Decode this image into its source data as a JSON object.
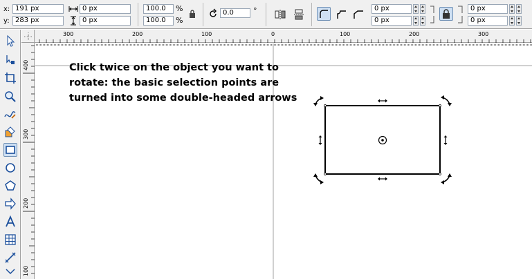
{
  "property_bar": {
    "x_label": "x:",
    "x_value": "191 px",
    "y_label": "y:",
    "y_value": "283 px",
    "width_value": "0 px",
    "height_value": "0 px",
    "scale_x": "100.0",
    "scale_y": "100.0",
    "percent": "%",
    "rotation": "0.0",
    "outline_width_1": "0 px",
    "outline_width_2": "0 px",
    "corner_1": "0 px",
    "corner_2": "0 px"
  },
  "rulers": {
    "horizontal": [
      "300",
      "200",
      "100",
      "0",
      "100",
      "200",
      "300"
    ],
    "vertical": [
      "400",
      "300",
      "200",
      "100"
    ]
  },
  "canvas": {
    "instruction_line1": "Click twice on the object you want to",
    "instruction_line2": "rotate: the basic selection points are",
    "instruction_line3": "turned into some double-headed arrows"
  }
}
